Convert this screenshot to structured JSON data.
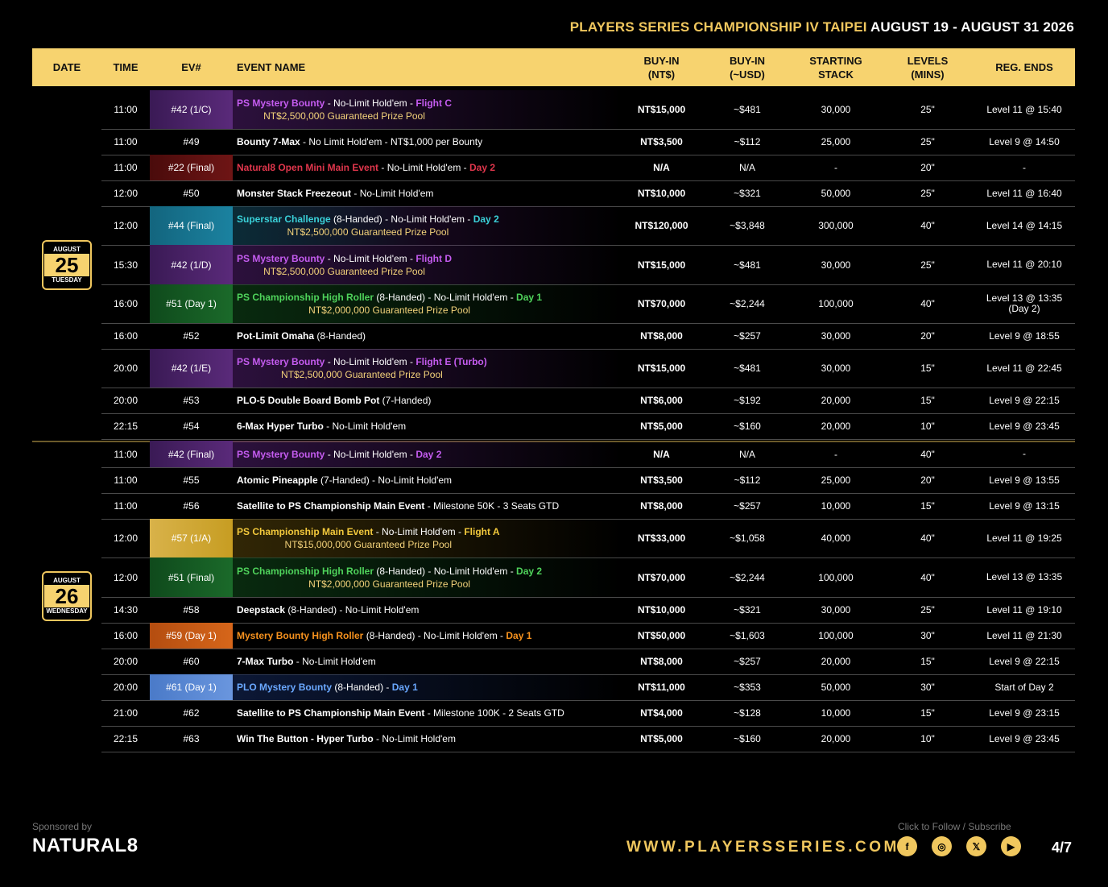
{
  "header": {
    "title_gold": "PLAYERS SERIES CHAMPIONSHIP IV TAIPEI",
    "title_white": "AUGUST 19 - AUGUST 31 2026"
  },
  "columns": {
    "date": "DATE",
    "time": "TIME",
    "ev": "EV#",
    "name": "EVENT NAME",
    "buyin_ntd_1": "BUY-IN",
    "buyin_ntd_2": "(NT$)",
    "buyin_usd_1": "BUY-IN",
    "buyin_usd_2": "(~USD)",
    "stack_1": "STARTING",
    "stack_2": "STACK",
    "levels_1": "LEVELS",
    "levels_2": "(MINS)",
    "reg": "REG. ENDS"
  },
  "days": [
    {
      "month": "AUGUST",
      "day": "25",
      "weekday": "TUESDAY"
    },
    {
      "month": "AUGUST",
      "day": "26",
      "weekday": "WEDNESDAY"
    }
  ],
  "rows": [
    {
      "time": "11:00",
      "ev": "#42 (1/C)",
      "ev_color": "purple",
      "parts": [
        {
          "t": "PS Mystery Bounty",
          "c": "purple"
        },
        {
          "t": " - No-Limit Hold'em - "
        },
        {
          "t": "Flight C",
          "c": "purple"
        }
      ],
      "gtd": "NT$2,500,000 Guaranteed Prize Pool",
      "buyin": "NT$15,000",
      "usd": "~$481",
      "stack": "30,000",
      "levels": "25\"",
      "reg": "Level 11 @ 15:40"
    },
    {
      "time": "11:00",
      "ev": "#49",
      "parts": [
        {
          "t": "Bounty 7-Max",
          "b": true
        },
        {
          "t": " - No Limit Hold'em - NT$1,000 per Bounty"
        }
      ],
      "buyin": "NT$3,500",
      "usd": "~$112",
      "stack": "25,000",
      "levels": "25\"",
      "reg": "Level 9 @ 14:50"
    },
    {
      "time": "11:00",
      "ev": "#22 (Final)",
      "ev_color": "red",
      "parts": [
        {
          "t": "Natural8 Open Mini Main Event",
          "c": "red"
        },
        {
          "t": " - No-Limit Hold'em - "
        },
        {
          "t": "Day 2",
          "c": "red"
        }
      ],
      "buyin": "N/A",
      "usd": "N/A",
      "stack": "-",
      "levels": "20\"",
      "reg": "-"
    },
    {
      "time": "12:00",
      "ev": "#50",
      "parts": [
        {
          "t": "Monster Stack Freezeout",
          "b": true
        },
        {
          "t": " - No-Limit Hold'em"
        }
      ],
      "buyin": "NT$10,000",
      "usd": "~$321",
      "stack": "50,000",
      "levels": "25\"",
      "reg": "Level 11 @ 16:40"
    },
    {
      "time": "12:00",
      "ev": "#44 (Final)",
      "ev_color": "teal",
      "parts": [
        {
          "t": "Superstar Challenge",
          "c": "teal"
        },
        {
          "t": " (8-Handed) - No-Limit Hold'em - "
        },
        {
          "t": "Day 2",
          "c": "teal"
        }
      ],
      "gtd": "NT$2,500,000 Guaranteed Prize Pool",
      "buyin": "NT$120,000",
      "usd": "~$3,848",
      "stack": "300,000",
      "levels": "40\"",
      "reg": "Level 14 @ 14:15"
    },
    {
      "time": "15:30",
      "ev": "#42 (1/D)",
      "ev_color": "purple",
      "parts": [
        {
          "t": "PS Mystery Bounty",
          "c": "purple"
        },
        {
          "t": " - No-Limit Hold'em - "
        },
        {
          "t": "Flight D",
          "c": "purple"
        }
      ],
      "gtd": "NT$2,500,000 Guaranteed Prize Pool",
      "buyin": "NT$15,000",
      "usd": "~$481",
      "stack": "30,000",
      "levels": "25\"",
      "reg": "Level 11 @ 20:10"
    },
    {
      "time": "16:00",
      "ev": "#51 (Day 1)",
      "ev_color": "green",
      "parts": [
        {
          "t": "PS Championship High Roller",
          "c": "green"
        },
        {
          "t": " (8-Handed) - No-Limit Hold'em - "
        },
        {
          "t": "Day 1",
          "c": "green"
        }
      ],
      "gtd": "NT$2,000,000 Guaranteed Prize Pool",
      "buyin": "NT$70,000",
      "usd": "~$2,244",
      "stack": "100,000",
      "levels": "40\"",
      "reg": "Level 13 @ 13:35\n(Day 2)"
    },
    {
      "time": "16:00",
      "ev": "#52",
      "parts": [
        {
          "t": "Pot-Limit Omaha",
          "b": true
        },
        {
          "t": " (8-Handed)"
        }
      ],
      "buyin": "NT$8,000",
      "usd": "~$257",
      "stack": "30,000",
      "levels": "20\"",
      "reg": "Level 9 @ 18:55"
    },
    {
      "time": "20:00",
      "ev": "#42 (1/E)",
      "ev_color": "purple",
      "parts": [
        {
          "t": "PS Mystery Bounty",
          "c": "purple"
        },
        {
          "t": " - No-Limit Hold'em - "
        },
        {
          "t": "Flight E (Turbo)",
          "c": "purple"
        }
      ],
      "gtd": "NT$2,500,000 Guaranteed Prize Pool",
      "buyin": "NT$15,000",
      "usd": "~$481",
      "stack": "30,000",
      "levels": "15\"",
      "reg": "Level 11 @ 22:45"
    },
    {
      "time": "20:00",
      "ev": "#53",
      "parts": [
        {
          "t": "PLO-5 Double Board Bomb Pot",
          "b": true
        },
        {
          "t": " (7-Handed)"
        }
      ],
      "buyin": "NT$6,000",
      "usd": "~$192",
      "stack": "20,000",
      "levels": "15\"",
      "reg": "Level 9 @ 22:15"
    },
    {
      "time": "22:15",
      "ev": "#54",
      "parts": [
        {
          "t": "6-Max Hyper Turbo",
          "b": true
        },
        {
          "t": " - No-Limit Hold'em"
        }
      ],
      "buyin": "NT$5,000",
      "usd": "~$160",
      "stack": "20,000",
      "levels": "10\"",
      "reg": "Level 9 @ 23:45"
    },
    {
      "time": "11:00",
      "ev": "#42 (Final)",
      "ev_color": "purple",
      "parts": [
        {
          "t": "PS Mystery Bounty",
          "c": "purple"
        },
        {
          "t": " - No-Limit Hold'em - "
        },
        {
          "t": "Day 2",
          "c": "purple"
        }
      ],
      "buyin": "N/A",
      "usd": "N/A",
      "stack": "-",
      "levels": "40\"",
      "reg": "-"
    },
    {
      "time": "11:00",
      "ev": "#55",
      "parts": [
        {
          "t": "Atomic Pineapple",
          "b": true
        },
        {
          "t": " (7-Handed) - No-Limit Hold'em"
        }
      ],
      "buyin": "NT$3,500",
      "usd": "~$112",
      "stack": "25,000",
      "levels": "20\"",
      "reg": "Level 9 @ 13:55"
    },
    {
      "time": "11:00",
      "ev": "#56",
      "parts": [
        {
          "t": "Satellite to PS Championship Main Event",
          "b": true
        },
        {
          "t": " - Milestone 50K - 3 Seats GTD"
        }
      ],
      "buyin": "NT$8,000",
      "usd": "~$257",
      "stack": "10,000",
      "levels": "15\"",
      "reg": "Level 9 @ 13:15"
    },
    {
      "time": "12:00",
      "ev": "#57 (1/A)",
      "ev_color": "gold",
      "parts": [
        {
          "t": "PS Championship Main Event",
          "c": "gold"
        },
        {
          "t": " - No-Limit Hold'em - "
        },
        {
          "t": "Flight A",
          "c": "gold"
        }
      ],
      "gtd": "NT$15,000,000 Guaranteed Prize Pool",
      "buyin": "NT$33,000",
      "usd": "~$1,058",
      "stack": "40,000",
      "levels": "40\"",
      "reg": "Level 11 @ 19:25"
    },
    {
      "time": "12:00",
      "ev": "#51 (Final)",
      "ev_color": "green",
      "parts": [
        {
          "t": "PS Championship High Roller",
          "c": "green"
        },
        {
          "t": " (8-Handed) - No-Limit Hold'em - "
        },
        {
          "t": "Day 2",
          "c": "green"
        }
      ],
      "gtd": "NT$2,000,000 Guaranteed Prize Pool",
      "buyin": "NT$70,000",
      "usd": "~$2,244",
      "stack": "100,000",
      "levels": "40\"",
      "reg": "Level 13 @ 13:35"
    },
    {
      "time": "14:30",
      "ev": "#58",
      "parts": [
        {
          "t": "Deepstack",
          "b": true
        },
        {
          "t": " (8-Handed) - No-Limit Hold'em"
        }
      ],
      "buyin": "NT$10,000",
      "usd": "~$321",
      "stack": "30,000",
      "levels": "25\"",
      "reg": "Level 11 @ 19:10"
    },
    {
      "time": "16:00",
      "ev": "#59 (Day 1)",
      "ev_color": "orange",
      "parts": [
        {
          "t": "Mystery Bounty High Roller",
          "c": "orange"
        },
        {
          "t": " (8-Handed) - No-Limit Hold'em - "
        },
        {
          "t": "Day 1",
          "c": "orange"
        }
      ],
      "buyin": "NT$50,000",
      "usd": "~$1,603",
      "stack": "100,000",
      "levels": "30\"",
      "reg": "Level 11 @ 21:30"
    },
    {
      "time": "20:00",
      "ev": "#60",
      "parts": [
        {
          "t": "7-Max Turbo",
          "b": true
        },
        {
          "t": " - No-Limit Hold'em"
        }
      ],
      "buyin": "NT$8,000",
      "usd": "~$257",
      "stack": "20,000",
      "levels": "15\"",
      "reg": "Level 9 @ 22:15"
    },
    {
      "time": "20:00",
      "ev": "#61 (Day 1)",
      "ev_color": "blue",
      "parts": [
        {
          "t": "PLO Mystery Bounty",
          "c": "blue"
        },
        {
          "t": " (8-Handed) - "
        },
        {
          "t": "Day 1",
          "c": "blue"
        }
      ],
      "buyin": "NT$11,000",
      "usd": "~$353",
      "stack": "50,000",
      "levels": "30\"",
      "reg": "Start of Day 2"
    },
    {
      "time": "21:00",
      "ev": "#62",
      "parts": [
        {
          "t": "Satellite to PS Championship Main Event",
          "b": true
        },
        {
          "t": " - Milestone 100K - 2 Seats GTD"
        }
      ],
      "buyin": "NT$4,000",
      "usd": "~$128",
      "stack": "10,000",
      "levels": "15\"",
      "reg": "Level 9 @ 23:15"
    },
    {
      "time": "22:15",
      "ev": "#63",
      "parts": [
        {
          "t": "Win The Button - Hyper Turbo",
          "b": true
        },
        {
          "t": " - No-Limit Hold'em"
        }
      ],
      "buyin": "NT$5,000",
      "usd": "~$160",
      "stack": "20,000",
      "levels": "10\"",
      "reg": "Level 9 @ 23:45"
    }
  ],
  "footer": {
    "sponsored": "Sponsored by",
    "sponsor_logo": "NATURAL8",
    "url": "WWW.PLAYERSSERIES.COM",
    "follow": "Click to Follow / Subscribe",
    "social": [
      {
        "icon": "facebook-icon",
        "glyph": "f"
      },
      {
        "icon": "instagram-icon",
        "glyph": "◎"
      },
      {
        "icon": "x-icon",
        "glyph": "𝕏"
      },
      {
        "icon": "youtube-icon",
        "glyph": "▶"
      }
    ],
    "page": "4/7"
  }
}
